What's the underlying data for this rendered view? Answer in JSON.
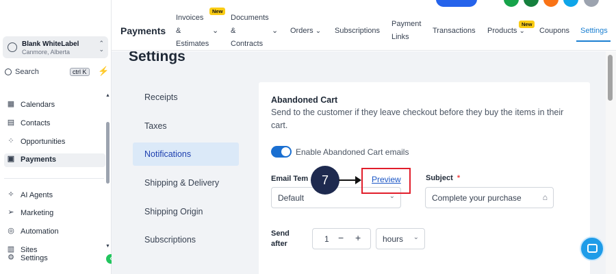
{
  "sidebar": {
    "account": {
      "name": "Blank WhiteLabel",
      "location": "Canmore, Alberta"
    },
    "search": {
      "label": "Search",
      "shortcut": "ctrl K"
    },
    "items": [
      {
        "label": "Calendars",
        "icon": "calendar-icon"
      },
      {
        "label": "Contacts",
        "icon": "contacts-icon"
      },
      {
        "label": "Opportunities",
        "icon": "opportunities-icon"
      },
      {
        "label": "Payments",
        "icon": "payments-icon",
        "active": true
      },
      {
        "label": "AI Agents",
        "icon": "ai-agents-icon"
      },
      {
        "label": "Marketing",
        "icon": "marketing-icon"
      },
      {
        "label": "Automation",
        "icon": "automation-icon"
      },
      {
        "label": "Sites",
        "icon": "sites-icon"
      },
      {
        "label": "Settings",
        "icon": "settings-icon"
      }
    ]
  },
  "topnav": {
    "title": "Payments",
    "tabs": [
      {
        "line1": "Invoices",
        "line2": "&",
        "line3": "Estimates",
        "badge": "New"
      },
      {
        "line1": "Documents",
        "line2": "&",
        "line3": "Contracts"
      },
      {
        "label": "Orders"
      },
      {
        "label": "Subscriptions"
      },
      {
        "line1": "Payment",
        "line2": "Links"
      },
      {
        "label": "Transactions"
      },
      {
        "label": "Products",
        "badge": "New"
      },
      {
        "label": "Coupons"
      },
      {
        "label": "Settings",
        "active": true
      }
    ]
  },
  "page": {
    "title": "Settings",
    "menu": [
      "Receipts",
      "Taxes",
      "Notifications",
      "Shipping & Delivery",
      "Shipping Origin",
      "Subscriptions"
    ],
    "active_menu": "Notifications"
  },
  "panel": {
    "title": "Abandoned Cart",
    "description": "Send to the customer if they leave checkout before they buy the items in their cart.",
    "toggle_label": "Enable Abandoned Cart emails",
    "email_template_label": "Email Tem",
    "email_template_value": "Default",
    "preview_label": "Preview",
    "subject_label": "Subject",
    "subject_required": "*",
    "subject_value": "Complete your purchase",
    "send_after_label_1": "Send",
    "send_after_label_2": "after",
    "send_after_value": "1",
    "send_after_unit": "hours"
  },
  "annotation": {
    "step": "7"
  },
  "colors": {
    "accent": "#1a7fd1",
    "highlight": "#e11d2a",
    "step_bg": "#1e2a4f",
    "badge": "#facc15"
  }
}
